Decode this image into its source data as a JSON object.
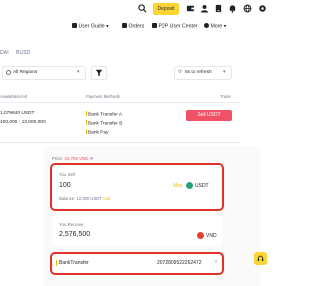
{
  "nav": {
    "deposit_label": "Deposit",
    "icons": [
      "search-icon",
      "deposit",
      "wallet-icon",
      "user-icon",
      "download-icon",
      "bell-icon",
      "globe-icon",
      "settings-icon"
    ],
    "menu": [
      {
        "label": "User Guide",
        "icon": "book-icon"
      },
      {
        "label": "Orders",
        "icon": "orders-icon"
      },
      {
        "label": "P2P User Center",
        "icon": "user-center-icon"
      },
      {
        "label": "More",
        "icon": "more-icon"
      }
    ]
  },
  "crypto_tabs": [
    "DAI",
    "BUSD"
  ],
  "filters": {
    "region": "All Regions",
    "refresh": "5s to refresh"
  },
  "table": {
    "headers": {
      "limit": "Available/Limit",
      "payment": "Payment Methods",
      "trade": "Trade"
    },
    "row": {
      "available": "1,079840 USDT",
      "limit": "100,000 - 13,000,000",
      "payments": [
        "Bank Transfer A",
        "Bank Transfer B",
        "Bank Pay"
      ],
      "action": "Sell USDT"
    }
  },
  "order": {
    "price_label": "Price",
    "price_value": "24,765 VND",
    "you_sell_label": "You Sell",
    "sell_amount": "100",
    "max_label": "Max",
    "sell_currency": "USDT",
    "balance_label": "Balance: 12,000 USDT",
    "add_label": "Add",
    "you_receive_label": "You Receive",
    "receive_amount": "2,576,500",
    "receive_currency": "VND",
    "payment_method": "BankTransfer",
    "account_number": "2072809522262472"
  },
  "colors": {
    "accent": "#fcd535",
    "sell": "#ef5167",
    "highlight": "#e0322b",
    "usdt": "#26a17b",
    "vnd": "#e8402f"
  }
}
